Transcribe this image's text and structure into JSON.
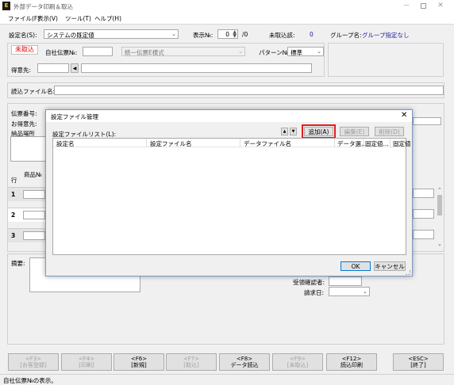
{
  "window": {
    "title": "外部データ印刷＆取込"
  },
  "menu": [
    "ファイル(F)",
    "表示(V)",
    "ツール(T)",
    "ヘルプ(H)"
  ],
  "toolbar": {
    "setting_label": "設定名(S):",
    "setting_value": "システムの既定値",
    "display_no_label": "表示№:",
    "display_no_value": "0",
    "display_no_total": "/0",
    "unimported_label": "未取込該:",
    "unimported_value": "0",
    "group_label": "グループ名:",
    "group_value": "グループ指定なし"
  },
  "form": {
    "status_badge": "未取込",
    "slip_no_label": "自社伝票№:",
    "slip_format_value": "統一伝票E様式",
    "pattern_label": "パターン№:",
    "pattern_value": "標準",
    "customer_label": "得意先:",
    "read_file_label": "読込ファイル名:",
    "slip_number_label": "伝票番号:",
    "customer2_label": "お得意先:",
    "delivery_label": "納品場所",
    "row_label": "行",
    "product_label": "商品№",
    "rows": [
      "1",
      "2",
      "3"
    ],
    "remarks_label": "摘要:",
    "receiver_label": "受領確認者:",
    "billing_date_label": "請求日:"
  },
  "fkeys": [
    {
      "key": "<F3>",
      "label": "[お客登録]",
      "enabled": false
    },
    {
      "key": "<F4>",
      "label": "[印刷]",
      "enabled": false
    },
    {
      "key": "<F6>",
      "label": "[新規]",
      "enabled": true
    },
    {
      "key": "<F7>",
      "label": "[取込]",
      "enabled": false
    },
    {
      "key": "<F8>",
      "label": "データ読込",
      "enabled": true
    },
    {
      "key": "<F9>",
      "label": "[未取込]",
      "enabled": false
    },
    {
      "key": "<F12>",
      "label": "読込印刷",
      "enabled": true
    },
    {
      "key": "<ESC>",
      "label": "[終了]",
      "enabled": true
    }
  ],
  "statusbar": {
    "text": "自社伝票№の表示。"
  },
  "dialog": {
    "title": "設定ファイル管理",
    "list_label": "設定ファイルリスト(L):",
    "add_button": "追加(A)",
    "edit_button": "編集(E)",
    "delete_button": "削除(D)",
    "columns": [
      "設定名",
      "設定ファイル名",
      "データファイル名",
      "データ選...",
      "固定値...",
      "固定値"
    ],
    "ok_button": "OK",
    "cancel_button": "キャンセル",
    "highlight_color": "#e02020"
  }
}
